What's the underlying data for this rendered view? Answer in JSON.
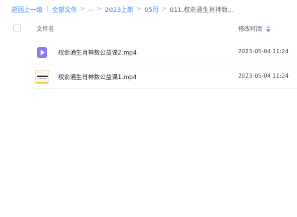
{
  "breadcrumb": {
    "back": "返回上一级",
    "all_files": "全部文件",
    "ellipsis": "...",
    "folder1": "2023上新",
    "folder2": "05月",
    "current": "011.权俞通生肖神数..."
  },
  "table": {
    "col_name": "文件名",
    "col_time": "修改时间",
    "rows": [
      {
        "name": "权俞通生肖神数公益课2.mp4",
        "time": "2023-05-04 11:24",
        "icon": "video-file-icon"
      },
      {
        "name": "权俞通生肖神数公益课1.mp4",
        "time": "2023-05-04 11:24",
        "icon": "video-thumbnail"
      }
    ]
  },
  "colors": {
    "link": "#3f8cff",
    "video_icon": "#8d7bf6"
  }
}
